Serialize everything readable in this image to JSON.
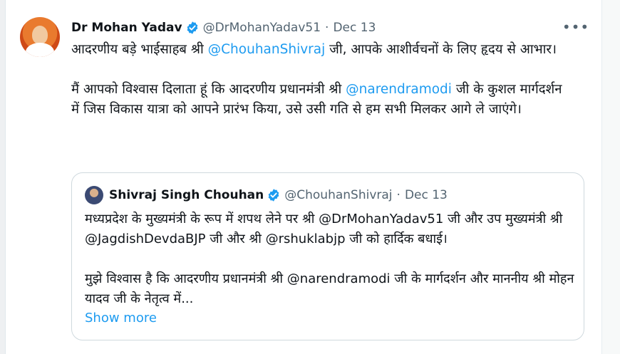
{
  "tweet": {
    "author_name": "Dr Mohan Yadav",
    "handle": "@DrMohanYadav51",
    "separator": "·",
    "date": "Dec 13",
    "more_label": "•••",
    "text_part1": "आदरणीय बड़े भाईसाहब श्री ",
    "mention1": "@ChouhanShivraj",
    "text_part2": " जी, आपके आशीर्वचनों के लिए हृदय से आभार।\n\nमैं आपको विश्वास दिलाता हूं कि आदरणीय प्रधानमंत्री श्री ",
    "mention2": "@narendramodi",
    "text_part3": " जी के कुशल मार्गदर्शन में जिस विकास यात्रा को आपने प्रारंभ किया, उसे उसी गति से हम सभी मिलकर आगे ले जाएंगे।"
  },
  "quote": {
    "author_name": "Shivraj Singh Chouhan",
    "handle": "@ChouhanShivraj",
    "separator": "·",
    "date": "Dec 13",
    "text": "मध्यप्रदेश के मुख्यमंत्री के रूप में शपथ लेने पर श्री @DrMohanYadav51 जी और उप मुख्यमंत्री श्री @JagdishDevdaBJP जी और श्री @rshuklabjp जी को हार्दिक बधाई।\n\nमुझे विश्वास है कि आदरणीय प्रधानमंत्री श्री @narendramodi जी के मार्गदर्शन और माननीय श्री मोहन यादव जी के नेतृत्व में...",
    "show_more": "Show more"
  },
  "colors": {
    "accent": "#1d9bf0",
    "text": "#0f1419",
    "muted": "#536471",
    "border": "#cfd9de"
  },
  "icons": {
    "verified": "verified-badge-icon",
    "more": "more-options-icon"
  }
}
